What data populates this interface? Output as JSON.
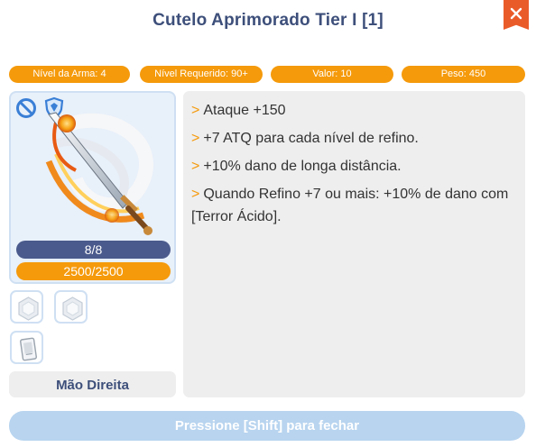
{
  "window": {
    "title": "Cutelo Aprimorado Tier I [1]",
    "close_icon": "close-icon"
  },
  "stats": [
    {
      "label": "Nível da Arma: 4"
    },
    {
      "label": "Nível Requerido: 90+"
    },
    {
      "label": "Valor: 10"
    },
    {
      "label": "Peso: 450"
    }
  ],
  "item": {
    "icons": [
      "forbid-icon",
      "shield-icon",
      "sword-icon"
    ],
    "durability": "8/8",
    "exp": "2500/2500",
    "slots": [
      "empty-card-slot-icon",
      "empty-card-slot-icon",
      "card-icon"
    ],
    "equip_location": "Mão Direita"
  },
  "description": {
    "bullet": ">",
    "lines": [
      "Ataque +150",
      "+7 ATQ para cada nível de refino.",
      "+10% dano de longa distância.",
      "Quando Refino +7 ou mais: +10% de dano com [Terror Ácido]."
    ]
  },
  "footer": {
    "close_hint": "Pressione [Shift] para fechar"
  },
  "colors": {
    "accent_orange": "#f59a0b",
    "title_blue": "#3d4f7a",
    "close_red": "#ea5b2a",
    "durability_bar": "#4a5a8c",
    "footer_button": "#b8d4ef"
  }
}
